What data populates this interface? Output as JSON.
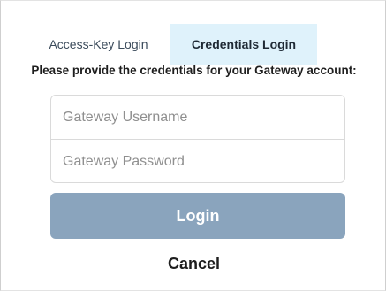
{
  "tabs": {
    "access_key_label": "Access-Key Login",
    "credentials_label": "Credentials Login",
    "active": "credentials"
  },
  "form": {
    "prompt": "Please provide the credentials for your Gateway account:",
    "username_placeholder": "Gateway Username",
    "username_value": "",
    "password_placeholder": "Gateway Password",
    "password_value": "",
    "login_label": "Login",
    "cancel_label": "Cancel"
  },
  "colors": {
    "active_tab_bg": "#dff2fb",
    "login_button_bg": "#8aa4bd",
    "text_dark": "#1e1e1e"
  }
}
